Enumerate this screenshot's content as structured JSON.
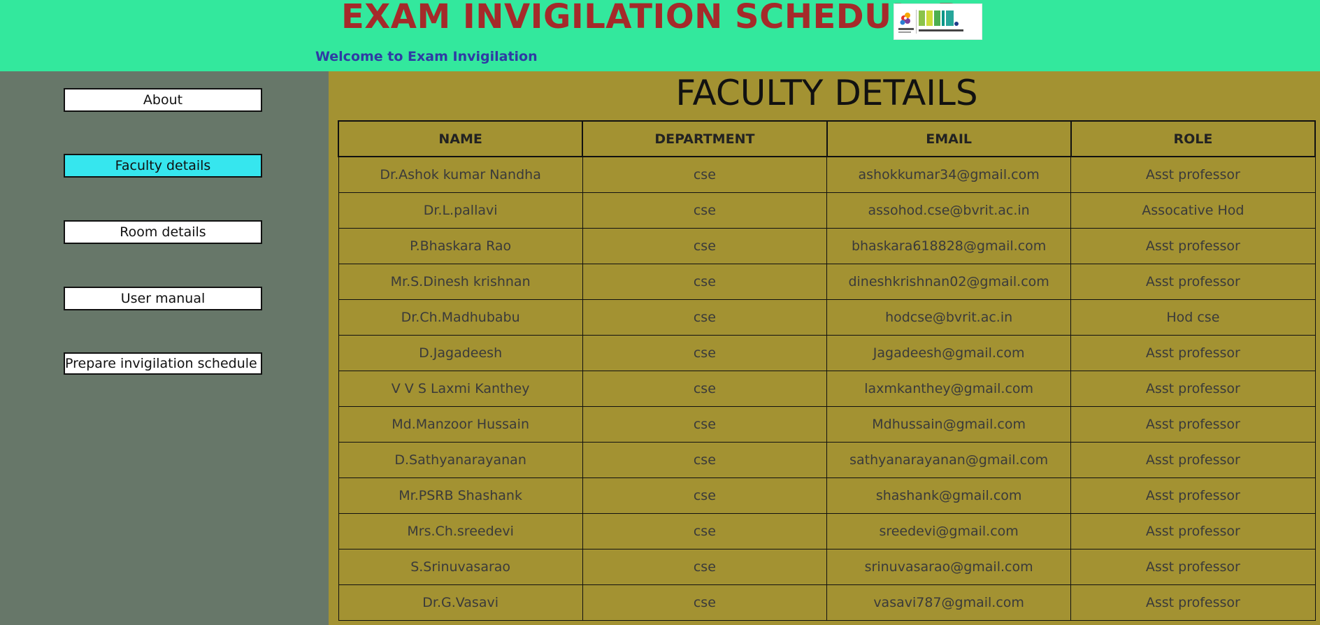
{
  "header": {
    "title": "EXAM INVIGILATION SCHEDULER",
    "welcome": "Welcome to Exam Invigilation",
    "logo": {
      "brand": "BVRIT",
      "group": "VISHNU",
      "subtitle": "B V Raju Institute of Technology"
    }
  },
  "sidebar": {
    "items": [
      {
        "label": "About",
        "active": false
      },
      {
        "label": "Faculty details",
        "active": true
      },
      {
        "label": "Room details",
        "active": false
      },
      {
        "label": "User manual",
        "active": false
      },
      {
        "label": "Prepare invigilation schedule",
        "active": false
      }
    ]
  },
  "main": {
    "title": "FACULTY DETAILS",
    "columns": [
      "NAME",
      "DEPARTMENT",
      "EMAIL",
      "ROLE"
    ],
    "rows": [
      [
        "Dr.Ashok kumar Nandha",
        "cse",
        "ashokkumar34@gmail.com",
        "Asst professor"
      ],
      [
        "Dr.L.pallavi",
        "cse",
        "assohod.cse@bvrit.ac.in",
        "Assocative Hod"
      ],
      [
        "P.Bhaskara Rao",
        "cse",
        "bhaskara618828@gmail.com",
        "Asst professor"
      ],
      [
        "Mr.S.Dinesh krishnan",
        "cse",
        "dineshkrishnan02@gmail.com",
        "Asst professor"
      ],
      [
        "Dr.Ch.Madhubabu",
        "cse",
        "hodcse@bvrit.ac.in",
        "Hod cse"
      ],
      [
        "D.Jagadeesh",
        "cse",
        "Jagadeesh@gmail.com",
        "Asst professor"
      ],
      [
        "V V S Laxmi Kanthey",
        "cse",
        "laxmkanthey@gmail.com",
        "Asst professor"
      ],
      [
        "Md.Manzoor Hussain",
        "cse",
        "Mdhussain@gmail.com",
        "Asst professor"
      ],
      [
        "D.Sathyanarayanan",
        "cse",
        "sathyanarayanan@gmail.com",
        "Asst professor"
      ],
      [
        "Mr.PSRB Shashank",
        "cse",
        "shashank@gmail.com",
        "Asst professor"
      ],
      [
        "Mrs.Ch.sreedevi",
        "cse",
        "sreedevi@gmail.com",
        "Asst professor"
      ],
      [
        "S.Srinuvasarao",
        "cse",
        "srinuvasarao@gmail.com",
        "Asst professor"
      ],
      [
        "Dr.G.Vasavi",
        "cse",
        "vasavi787@gmail.com",
        "Asst professor"
      ]
    ]
  },
  "colors": {
    "header_bg": "#33e89d",
    "title": "#a52a2a",
    "welcome": "#2f3ba4",
    "sidebar_bg": "#677769",
    "main_bg": "#a39232",
    "active_nav": "#36e6ee"
  }
}
